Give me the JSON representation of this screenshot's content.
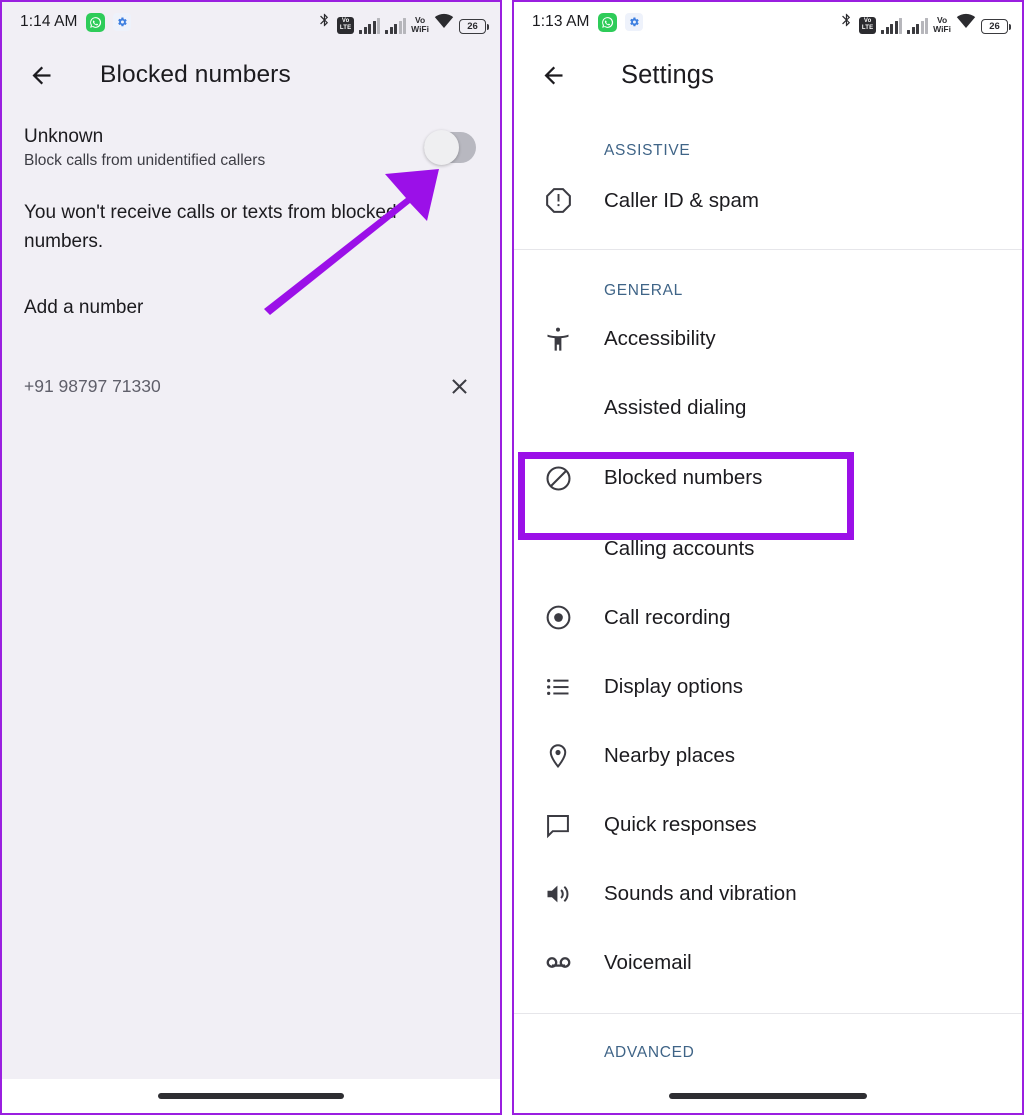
{
  "left_phone": {
    "status_bar": {
      "time": "1:14 AM",
      "icons": [
        "whatsapp-icon",
        "gear-icon",
        "bluetooth-icon",
        "volte-icon",
        "signal-bars-1",
        "signal-bars-2",
        "vowifi-icon",
        "wifi-icon",
        "battery-icon"
      ],
      "volte_line1": "Vo",
      "volte_line2": "LTE",
      "vowifi_line1": "Vo",
      "vowifi_line2": "WiFi",
      "battery_level": "26"
    },
    "appbar": {
      "title": "Blocked numbers",
      "back_icon": "back-arrow-icon"
    },
    "unknown": {
      "title": "Unknown",
      "subtitle": "Block calls from unidentified callers",
      "toggle_state": "off"
    },
    "info_text": "You won't receive calls or texts from blocked numbers.",
    "add_number_label": "Add a number",
    "blocked_list": [
      {
        "number": "+91 98797 71330",
        "remove_icon": "close-x-icon"
      }
    ],
    "annotation": {
      "type": "arrow",
      "color": "#9b10e8",
      "points_to": "unknown-toggle"
    }
  },
  "right_phone": {
    "status_bar": {
      "time": "1:13 AM",
      "volte_line1": "Vo",
      "volte_line2": "LTE",
      "vowifi_line1": "Vo",
      "vowifi_line2": "WiFi",
      "battery_level": "26"
    },
    "appbar": {
      "title": "Settings",
      "back_icon": "back-arrow-icon"
    },
    "sections": [
      {
        "header": "ASSISTIVE",
        "items": [
          {
            "label": "Caller ID & spam",
            "icon": "report-octagon-icon",
            "highlighted": false
          }
        ]
      },
      {
        "header": "GENERAL",
        "items": [
          {
            "label": "Accessibility",
            "icon": "accessibility-icon",
            "highlighted": false
          },
          {
            "label": "Assisted dialing",
            "icon": "",
            "highlighted": false
          },
          {
            "label": "Blocked numbers",
            "icon": "block-circle-icon",
            "highlighted": true
          },
          {
            "label": "Calling accounts",
            "icon": "",
            "highlighted": false
          },
          {
            "label": "Call recording",
            "icon": "record-dot-icon",
            "highlighted": false
          },
          {
            "label": "Display options",
            "icon": "list-icon",
            "highlighted": false
          },
          {
            "label": "Nearby places",
            "icon": "location-pin-icon",
            "highlighted": false
          },
          {
            "label": "Quick responses",
            "icon": "chat-bubble-icon",
            "highlighted": false
          },
          {
            "label": "Sounds and vibration",
            "icon": "speaker-icon",
            "highlighted": false
          },
          {
            "label": "Voicemail",
            "icon": "voicemail-icon",
            "highlighted": false
          }
        ]
      },
      {
        "header": "ADVANCED",
        "items": []
      }
    ],
    "annotation": {
      "type": "highlight-box",
      "color": "#9b10e8",
      "target": "Blocked numbers"
    }
  },
  "colors": {
    "annotation_purple": "#9b10e8",
    "panel_border": "#9a1fe0",
    "section_header": "#3f6487",
    "left_bg": "#f1eff5"
  }
}
